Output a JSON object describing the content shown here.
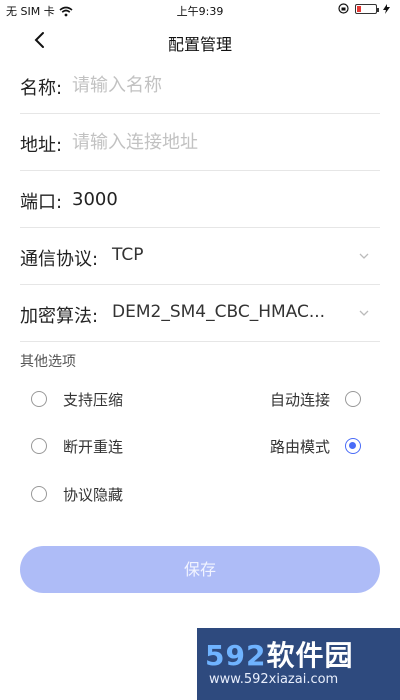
{
  "status_bar": {
    "carrier": "无 SIM 卡",
    "time": "上午9:39",
    "wifi_icon": "wifi-icon",
    "lock_icon": "orientation-lock-icon",
    "battery_icon": "battery-low-icon",
    "charging_icon": "charging-bolt-icon"
  },
  "nav": {
    "title": "配置管理",
    "back_icon": "chevron-left-icon"
  },
  "form": {
    "name": {
      "label": "名称:",
      "placeholder": "请输入名称",
      "value": ""
    },
    "address": {
      "label": "地址:",
      "placeholder": "请输入连接地址",
      "value": ""
    },
    "port": {
      "label": "端口:",
      "value": "3000"
    },
    "protocol": {
      "label": "通信协议:",
      "value": "TCP"
    },
    "encryption": {
      "label": "加密算法:",
      "value": "DEM2_SM4_CBC_HMAC..."
    }
  },
  "options": {
    "title": "其他选项",
    "items": [
      {
        "label": "支持压缩",
        "checked": false
      },
      {
        "label": "自动连接",
        "checked": false
      },
      {
        "label": "断开重连",
        "checked": false
      },
      {
        "label": "路由模式",
        "checked": true
      },
      {
        "label": "协议隐藏",
        "checked": false
      }
    ]
  },
  "save_label": "保存",
  "colors": {
    "accent": "#4a6cf7",
    "save_button": "#aebcf7",
    "battery_low": "#e53935"
  },
  "watermark": {
    "brand_num": "592",
    "brand_text": "软件园",
    "url": "www.592xiazai.com"
  }
}
